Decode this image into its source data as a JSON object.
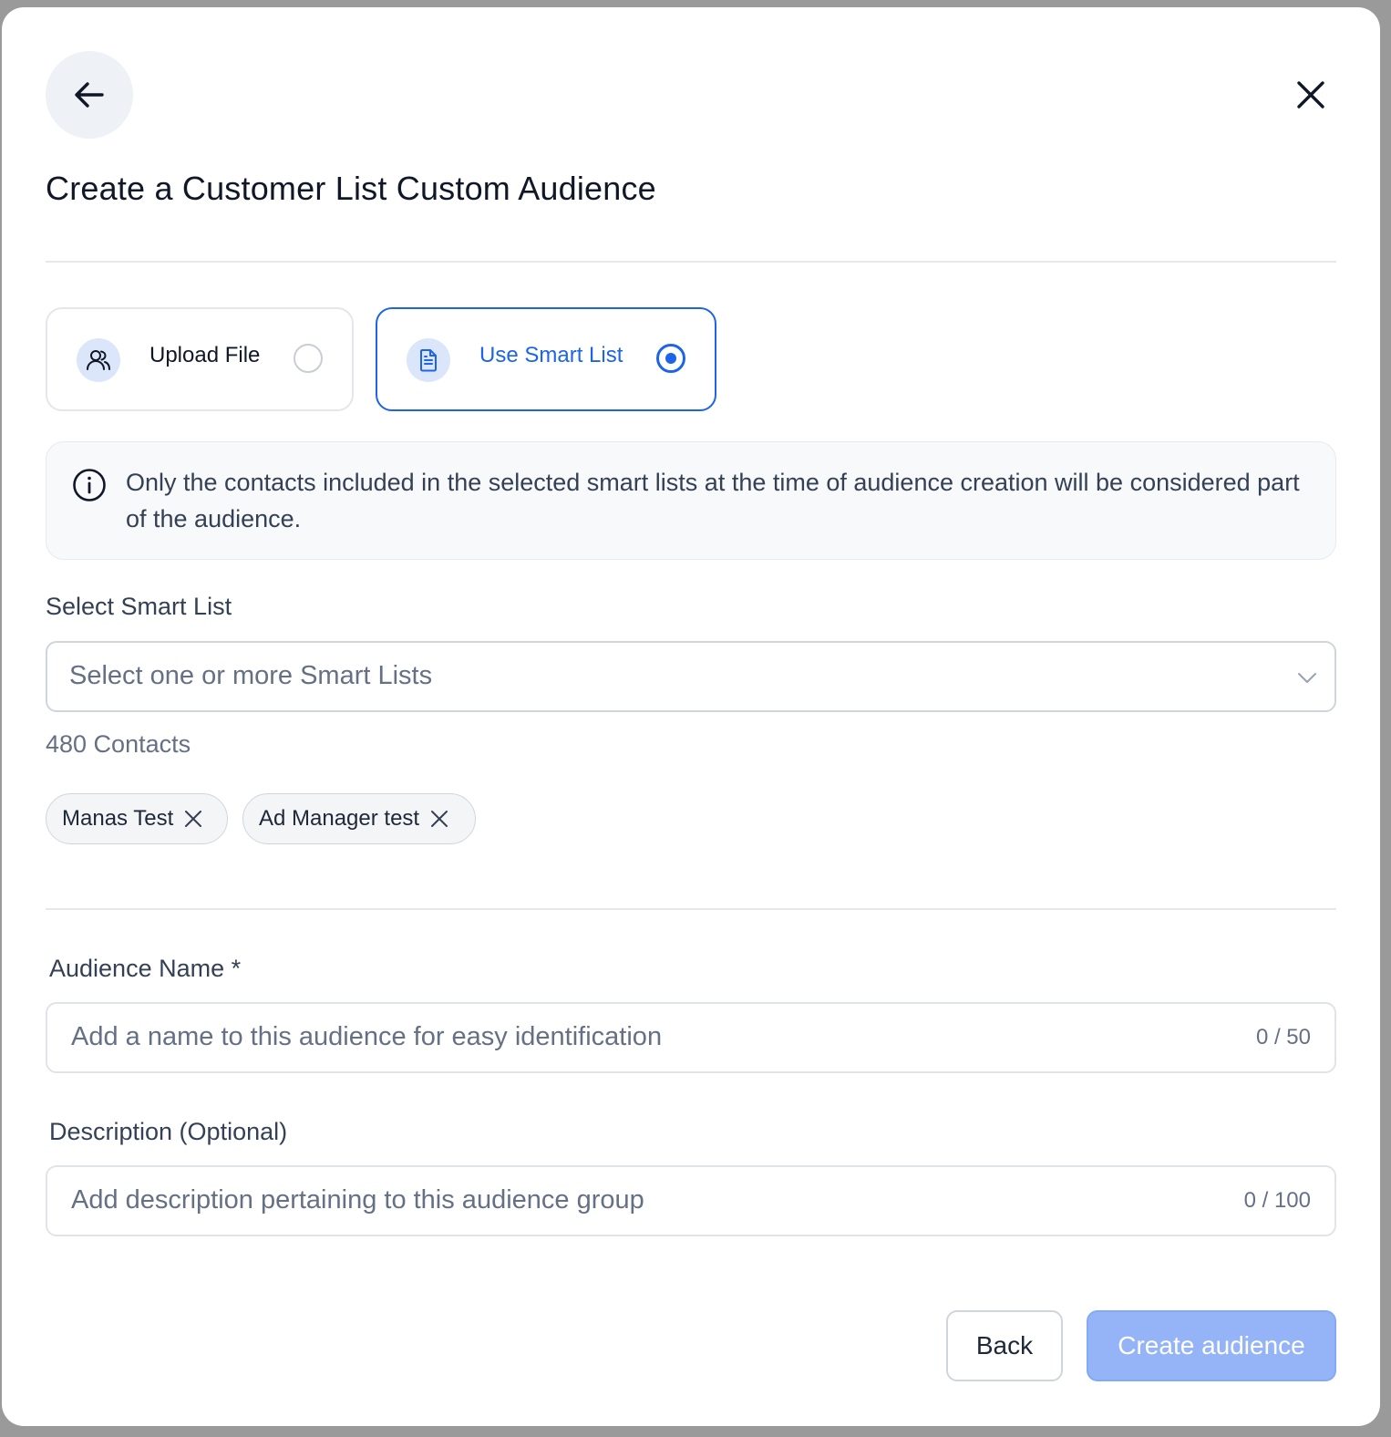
{
  "dialog": {
    "title": "Create a Customer List Custom Audience",
    "back_icon": "arrow-left-icon",
    "close_icon": "close-icon"
  },
  "source_options": [
    {
      "label": "Upload File",
      "icon": "users-icon",
      "selected": false
    },
    {
      "label": "Use Smart List",
      "icon": "document-icon",
      "selected": true
    }
  ],
  "info": {
    "icon": "info-icon",
    "text": "Only the contacts included in the selected smart lists at the time of audience creation will be considered part of the audience."
  },
  "smart_list": {
    "label": "Select Smart List",
    "placeholder": "Select one or more Smart Lists",
    "contacts_count": "480 Contacts",
    "selected": [
      {
        "label": "Manas Test"
      },
      {
        "label": "Ad Manager test"
      }
    ]
  },
  "audience_name": {
    "label": "Audience Name *",
    "placeholder": "Add a name to this audience for easy identification",
    "counter": "0 / 50"
  },
  "description": {
    "label": "Description (Optional)",
    "placeholder": "Add description pertaining to this audience group",
    "counter": "0 / 100"
  },
  "footer": {
    "back_label": "Back",
    "create_label": "Create audience"
  },
  "colors": {
    "accent": "#1d64e8",
    "primary_button_disabled": "#94b4f7",
    "text": "#101828",
    "muted_text": "#667085"
  }
}
